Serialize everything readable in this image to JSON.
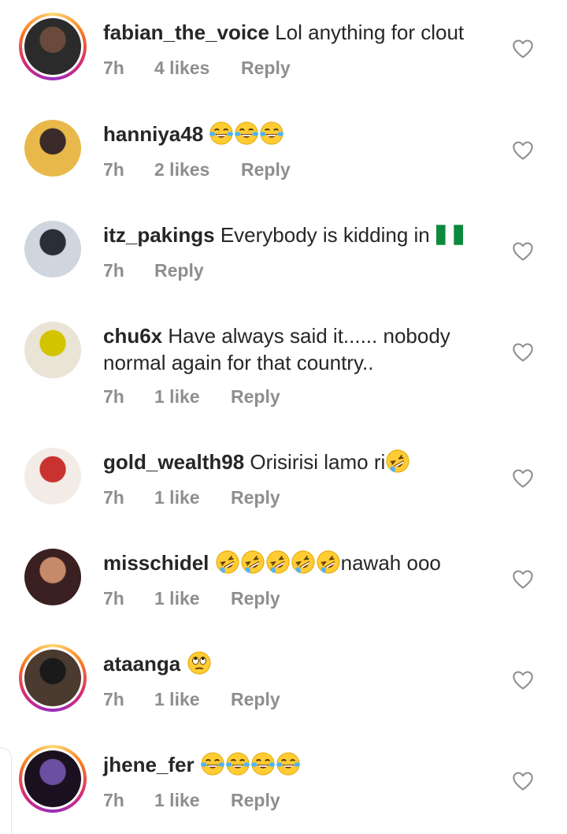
{
  "comments": [
    {
      "username": "fabian_the_voice",
      "text": " Lol anything for clout",
      "time": "7h",
      "likes": "4 likes",
      "reply": "Reply",
      "emojis": []
    },
    {
      "username": "hanniya48",
      "text": "",
      "time": "7h",
      "likes": "2 likes",
      "reply": "Reply",
      "emojis": [
        "tears-of-joy",
        "tears-of-joy",
        "tears-of-joy"
      ]
    },
    {
      "username": "itz_pakings",
      "text": " Everybody is kidding in ",
      "time": "7h",
      "likes": "",
      "reply": "Reply",
      "emojis": [
        "nigeria-flag"
      ]
    },
    {
      "username": "chu6x",
      "text": " Have always said it...... nobody",
      "text2": "normal again for that country..",
      "time": "7h",
      "likes": "1 like",
      "reply": "Reply",
      "emojis": []
    },
    {
      "username": "gold_wealth98",
      "text": " Orisirisi lamo ri",
      "time": "7h",
      "likes": "1 like",
      "reply": "Reply",
      "emojis": [
        "rofl"
      ]
    },
    {
      "username": "misschidel",
      "text": "nawah ooo",
      "time": "7h",
      "likes": "1 like",
      "reply": "Reply",
      "emojis": [
        "rofl",
        "rofl",
        "rofl",
        "rofl",
        "rofl"
      ]
    },
    {
      "username": "ataanga",
      "text": "",
      "time": "7h",
      "likes": "1 like",
      "reply": "Reply",
      "emojis": [
        "eye-roll"
      ]
    },
    {
      "username": "jhene_fer",
      "text": "",
      "time": "7h",
      "likes": "1 like",
      "reply": "Reply",
      "emojis": [
        "tears-of-joy",
        "tears-of-joy",
        "tears-of-joy",
        "tears-of-joy"
      ]
    }
  ],
  "icons": {
    "like": "heart-outline-icon"
  },
  "colors": {
    "text": "#262626",
    "meta": "#8e8e8e",
    "story_ring": "#d62976"
  }
}
